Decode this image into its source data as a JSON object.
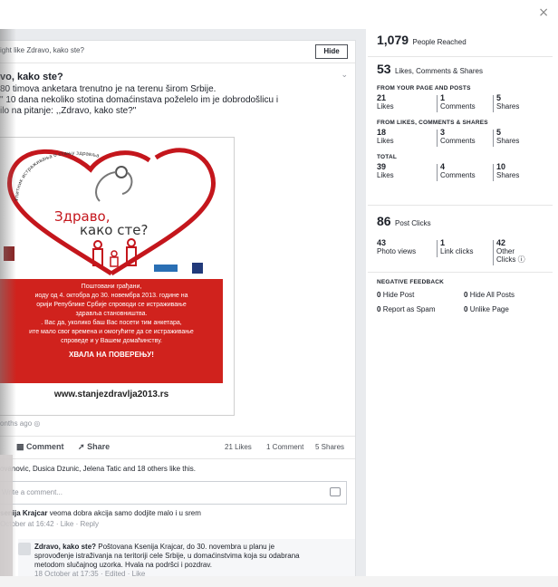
{
  "modal": {
    "close_label": "×"
  },
  "suggestion": {
    "text": "ight like Zdravo, kako ste?",
    "hide_label": "Hide"
  },
  "post": {
    "title": "vo, kako ste?",
    "body_lines": [
      "80 timova anketara trenutno je na terenu širom Srbije.",
      "\" 10 dana nekoliko stotina domaćinstava poželelo im je dobrodošlicu i",
      "ilo na pitanje: ,,Zdravo, kako ste?\""
    ],
    "chevron": "⌄",
    "image": {
      "arc_text": "Упитник истраживања о стању здравља у Србији",
      "heart_title_1": "Здраво,",
      "heart_title_2": "како сте?",
      "red_lines": [
        "Поштовани грађани,",
        "иоду од 4. октобра до 30. новембра 2013. године на",
        "орији Републике Србије спроводи се истраживање",
        "здравља становништва.",
        ". Вас да, уколико баш Вас посети тим анкетара,",
        "ите мало свог времена и омогућите да се истраживање",
        "спроведе и у Вашем домаћинству."
      ],
      "red_bold": "ХВАЛА НА ПОВЕРЕЊУ!",
      "url": "www.stanjezdravlja2013.rs"
    },
    "time": "onths ago",
    "actions": {
      "comment": "Comment",
      "share": "Share"
    },
    "counts": {
      "likes": "21 Likes",
      "comments": "1 Comment",
      "shares": "5 Shares"
    },
    "likers": "ovanovic, Dusica Dzunic, Jelena Tatic and 18 others like this.",
    "comment_placeholder": "Write a comment...",
    "comments": [
      {
        "author": "senija Krajcar",
        "text": "veoma dobra akcija samo dodjite malo i u srem",
        "meta": "October at 16:42 · Like · Reply"
      },
      {
        "author": "Zdravo, kako ste?",
        "text_lines": [
          "Poštovana Ksenija Krajcar, do 30. novembra u planu je",
          "sprovođenje istraživanja na teritoriji cele Srbije, u domaćinstvima koja su odabrana",
          "metodom slučajnog uzorka. Hvala na podršci i pozdrav."
        ],
        "meta": "18 October at 17:35 · Edited · Like"
      }
    ]
  },
  "insights": {
    "reach_value": "1,079",
    "reach_label": "People Reached",
    "engagement_value": "53",
    "engagement_label": "Likes, Comments & Shares",
    "from_page_label": "FROM YOUR PAGE AND POSTS",
    "from_page": [
      {
        "value": "21",
        "label": "Likes"
      },
      {
        "value": "1",
        "label": "Comments"
      },
      {
        "value": "5",
        "label": "Shares"
      }
    ],
    "from_shares_label": "FROM LIKES, COMMENTS & SHARES",
    "from_shares": [
      {
        "value": "18",
        "label": "Likes"
      },
      {
        "value": "3",
        "label": "Comments"
      },
      {
        "value": "5",
        "label": "Shares"
      }
    ],
    "total_label": "TOTAL",
    "total": [
      {
        "value": "39",
        "label": "Likes"
      },
      {
        "value": "4",
        "label": "Comments"
      },
      {
        "value": "10",
        "label": "Shares"
      }
    ],
    "clicks_value": "86",
    "clicks_label": "Post Clicks",
    "clicks": [
      {
        "value": "43",
        "label": "Photo views"
      },
      {
        "value": "1",
        "label": "Link clicks"
      },
      {
        "value": "42",
        "label": "Other Clicks"
      }
    ],
    "negative_label": "NEGATIVE FEEDBACK",
    "negative": [
      {
        "value": "0",
        "label": "Hide Post"
      },
      {
        "value": "0",
        "label": "Hide All Posts"
      },
      {
        "value": "0",
        "label": "Report as Spam"
      },
      {
        "value": "0",
        "label": "Unlike Page"
      }
    ]
  }
}
